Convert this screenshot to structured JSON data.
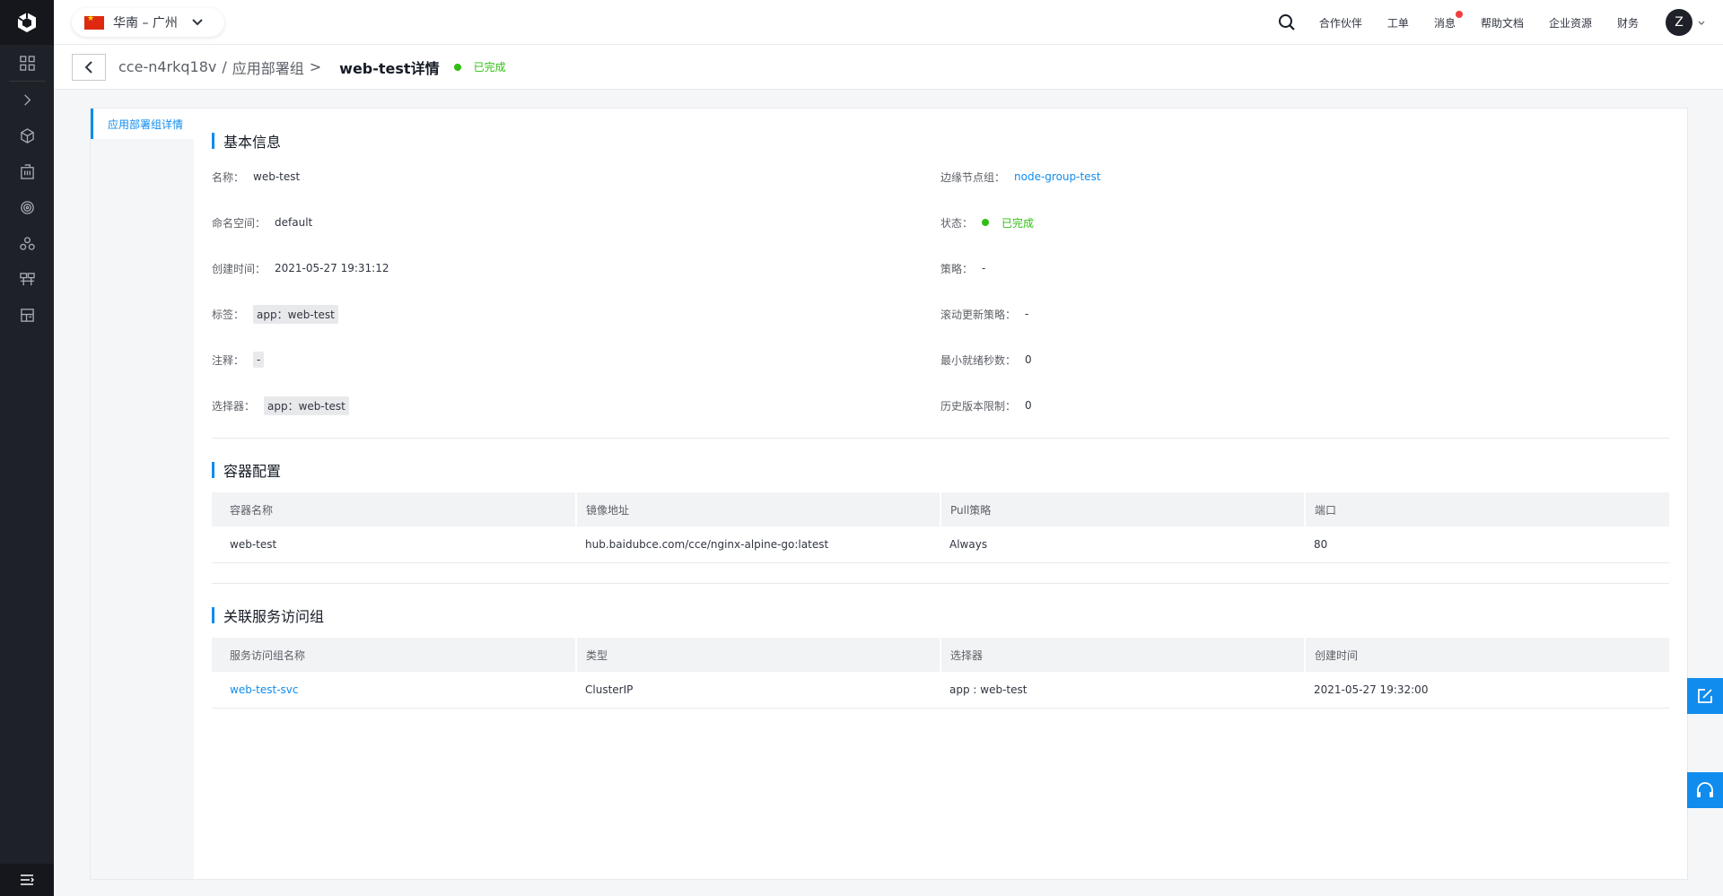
{
  "topbar": {
    "region": "华南 – 广州",
    "links": [
      "合作伙伴",
      "工单",
      "消息",
      "帮助文档",
      "企业资源",
      "财务"
    ],
    "avatar": "Z"
  },
  "header": {
    "breadcrumb_cluster": "cce-n4rkq18v",
    "breadcrumb_sep1": "/",
    "breadcrumb_section": "应用部署组",
    "breadcrumb_sep2": ">",
    "title": "web-test详情",
    "status": "已完成"
  },
  "subnav": {
    "active": "应用部署组详情"
  },
  "basic": {
    "title": "基本信息",
    "name_key": "名称：",
    "name": "web-test",
    "ns_key": "命名空间：",
    "ns": "default",
    "created_key": "创建时间：",
    "created": "2021-05-27 19:31:12",
    "labels_key": "标签：",
    "labels": "app：web-test",
    "annot_key": "注释：",
    "annot": "-",
    "selector_key": "选择器：",
    "selector": "app：web-test",
    "nodegroup_key": "边缘节点组：",
    "nodegroup": "node-group-test",
    "status_key": "状态：",
    "status": "已完成",
    "strategy_key": "策略：",
    "strategy": "-",
    "rolling_key": "滚动更新策略：",
    "rolling": "-",
    "minready_key": "最小就绪秒数：",
    "minready": "0",
    "history_key": "历史版本限制：",
    "history": "0"
  },
  "containers": {
    "title": "容器配置",
    "headers": [
      "容器名称",
      "镜像地址",
      "Pull策略",
      "端口"
    ],
    "rows": [
      [
        "web-test",
        "hub.baidubce.com/cce/nginx-alpine-go:latest",
        "Always",
        "80"
      ]
    ]
  },
  "services": {
    "title": "关联服务访问组",
    "headers": [
      "服务访问组名称",
      "类型",
      "选择器",
      "创建时间"
    ],
    "rows": [
      [
        "web-test-svc",
        "ClusterIP",
        "app : web-test",
        "2021-05-27 19:32:00"
      ]
    ]
  },
  "colors": {
    "accent": "#108cee",
    "success": "#30bf13",
    "rail": "#1f2128"
  },
  "icons": [
    "logo-icon",
    "grid-icon",
    "chevron-right-icon",
    "cube-icon",
    "building-icon",
    "target-icon",
    "users-icon",
    "network-icon",
    "storage-icon",
    "menu-icon",
    "search-icon",
    "chevron-down-icon",
    "back-icon",
    "edit-icon",
    "headset-icon"
  ]
}
